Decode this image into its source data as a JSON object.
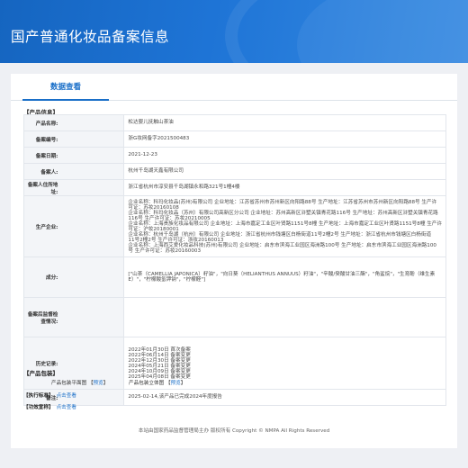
{
  "header": {
    "title": "国产普通化妆品备案信息"
  },
  "tab": {
    "label": "数据查看"
  },
  "product_info": {
    "section_title": "【产品信息】",
    "rows": [
      {
        "label": "产品名称:",
        "value": "松达婴儿抚触山茶油"
      },
      {
        "label": "备案编号:",
        "value": "浙G妆网备字2021500483"
      },
      {
        "label": "备案日期:",
        "value": "2021-12-23"
      },
      {
        "label": "备案人:",
        "value": "杭州千岛湖天鑫有限公司"
      },
      {
        "label": "备案人住所地址:",
        "value": "浙江省杭州市淳安县千岛湖镇永和路321号1幢4楼"
      }
    ],
    "producer_label": "生产企业:",
    "producer_lines": [
      "企业名称：科玛化妆品(苏州)有限公司 企业地址：江苏省苏州市苏州新区向阳路88号 生产地址：江苏省苏州市苏州新区向阳路88号 生产许",
      "可证：苏妆20160108",
      "企业名称：科玛化妆品（苏州）有限公司高新区分公司 企业地址：苏州高新区浒墅关镇青花路116号 生产地址：苏州高新区浒墅关镇青花路",
      "116号 生产许可证：苏妆20210005",
      "企业名称：上海贵族化妆品有限公司 企业地址：上海市嘉定工业区叶贤路1151号8幢 生产地址：上海市嘉定工业区叶贤路1151号8幢 生产许",
      "可证：沪妆20180001",
      "企业名称：杭州千岛湖（杭州）有限公司 企业地址：浙江省杭州市钱塘区白杨街道11号2幢2号 生产地址：浙江省杭州市钱塘区白杨街道",
      "11号2幢2号 生产许可证：浙妆20160013",
      "企业名称：上海西艾爱化妆品科技(苏州)有限公司 企业地址：启东市滨海工业园区海洲路100号 生产地址：启东市滨海工业园区海洲路100",
      "号 生产许可证：苏妆20160003"
    ],
    "ingredients_label": "成分:",
    "ingredients_lines": [
      "[\"山茶（CAMELLIA JAPONICA）籽油\"，\"向日葵（HELIANTHUS ANNUUS）籽油\"，\"辛酸/癸酸甘油三酯\"，\"角鲨烷\"，\"生育酚（维生素",
      "E）\"，\"柠檬酸氢钾钠\"，\"柠檬醛\"]"
    ],
    "inspection_label": "备案后监督检查情况:",
    "inspection_value": "",
    "history_label": "历史记录:",
    "history_lines": [
      "2022年01月30日 首次备案",
      "2022年06月14日 备案变更",
      "2022年12月30日 备案变更",
      "2024年05月21日 备案变更",
      "2024年10月09日 备案变更",
      "2025年04月08日 备案变更"
    ],
    "remark_label": "备注:",
    "remark_value": "2025-02-14,该产品已完成2024年度报告"
  },
  "packaging": {
    "section_title": "【产品包装】",
    "flat_label": "产品包装平面图",
    "flat_link": "预览",
    "stereo_label": "产品包装立体图",
    "stereo_link": "预览"
  },
  "standard": {
    "label": "【执行标准】",
    "link": "点击查看"
  },
  "efficacy": {
    "label": "【功效宣称】",
    "link": "点击查看"
  },
  "footer": {
    "text": "本站由国家药品监督管理局主办 版权所有 Copyright © NMPA All Rights Reserved"
  }
}
